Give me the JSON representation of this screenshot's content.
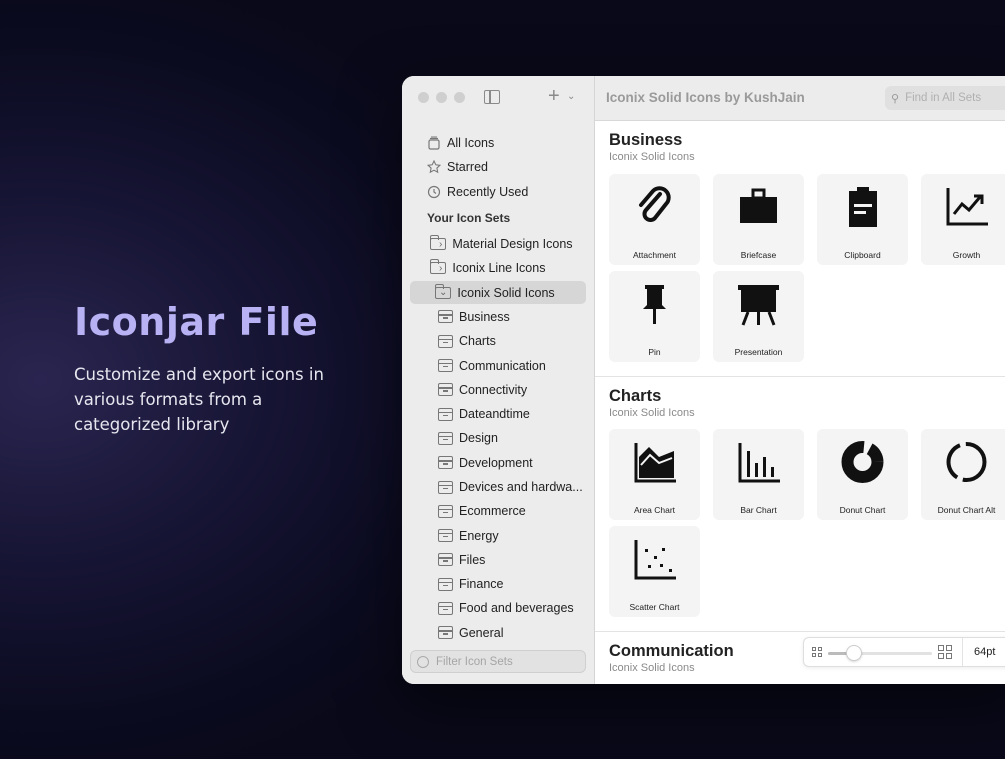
{
  "hero": {
    "title": "Iconjar File",
    "description": "Customize and export icons in various formats from a categorized library"
  },
  "sidebar": {
    "library": [
      {
        "label": "All Icons",
        "icon": "stack-icon"
      },
      {
        "label": "Starred",
        "icon": "star-icon"
      },
      {
        "label": "Recently Used",
        "icon": "clock-icon"
      }
    ],
    "heading": "Your Icon Sets",
    "sets": [
      {
        "label": "Material Design Icons",
        "expanded": false
      },
      {
        "label": "Iconix Line Icons",
        "expanded": false
      },
      {
        "label": "Iconix Solid Icons",
        "expanded": true,
        "selected": true
      }
    ],
    "groups": [
      "Business",
      "Charts",
      "Communication",
      "Connectivity",
      "Dateandtime",
      "Design",
      "Development",
      "Devices and hardwa...",
      "Ecommerce",
      "Energy",
      "Files",
      "Finance",
      "Food and beverages",
      "General"
    ],
    "filter_placeholder": "Filter Icon Sets"
  },
  "toolbar": {
    "title": "Iconix Solid Icons by KushJain",
    "search_placeholder": "Find in All Sets"
  },
  "sections": [
    {
      "title": "Business",
      "subtitle": "Iconix Solid Icons",
      "icons": [
        "Attachment",
        "Briefcase",
        "Clipboard",
        "Growth",
        "Pin",
        "Presentation"
      ]
    },
    {
      "title": "Charts",
      "subtitle": "Iconix Solid Icons",
      "icons": [
        "Area Chart",
        "Bar Chart",
        "Donut Chart",
        "Donut Chart Alt",
        "Scatter Chart"
      ]
    },
    {
      "title": "Communication",
      "subtitle": "Iconix Solid Icons",
      "icons": []
    }
  ],
  "zoom": {
    "value_label": "64pt",
    "slider_level": 0.25
  }
}
